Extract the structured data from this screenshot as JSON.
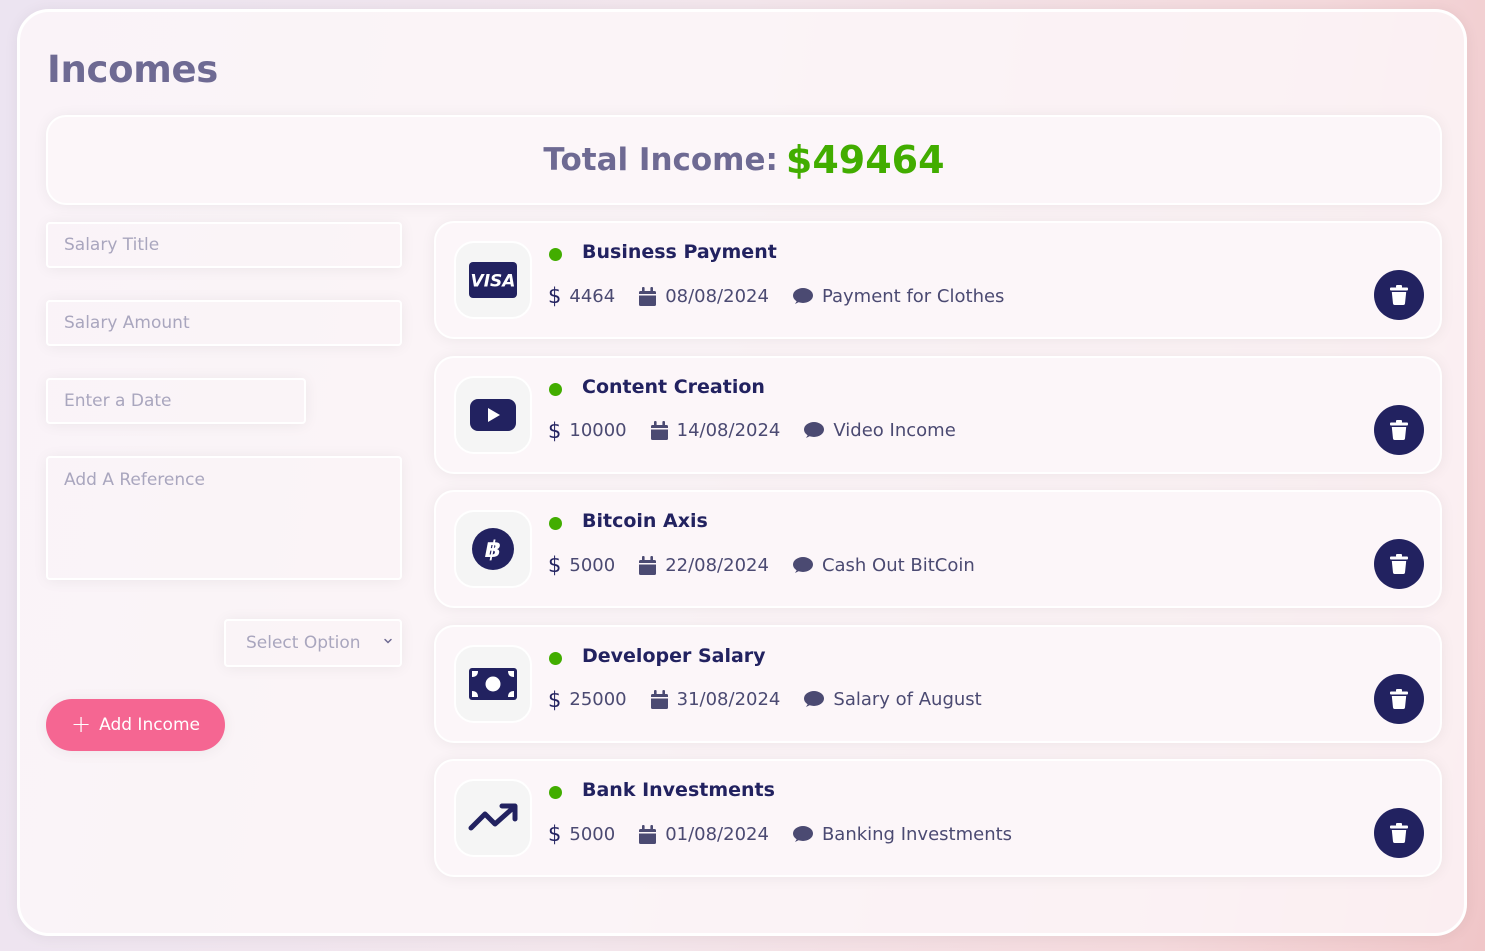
{
  "page": {
    "title": "Incomes"
  },
  "total": {
    "label": "Total Income:",
    "value": "$49464"
  },
  "form": {
    "title_placeholder": "Salary Title",
    "amount_placeholder": "Salary Amount",
    "date_placeholder": "Enter a Date",
    "reference_placeholder": "Add A Reference",
    "select_label": "Select Option",
    "add_button_label": "Add Income"
  },
  "incomes": [
    {
      "title": "Business Payment",
      "amount": "4464",
      "date": "08/08/2024",
      "description": "Payment for Clothes",
      "icon": "visa-icon"
    },
    {
      "title": "Content Creation",
      "amount": "10000",
      "date": "14/08/2024",
      "description": "Video Income",
      "icon": "youtube-icon"
    },
    {
      "title": "Bitcoin Axis",
      "amount": "5000",
      "date": "22/08/2024",
      "description": "Cash Out BitCoin",
      "icon": "bitcoin-icon"
    },
    {
      "title": "Developer Salary",
      "amount": "25000",
      "date": "31/08/2024",
      "description": "Salary of August",
      "icon": "money-bill-icon"
    },
    {
      "title": "Bank Investments",
      "amount": "5000",
      "date": "01/08/2024",
      "description": "Banking Investments",
      "icon": "trend-up-icon"
    }
  ],
  "colors": {
    "primary": "#222260",
    "title": "#6e6a93",
    "green": "#42ad00",
    "add_button": "#f56692"
  }
}
